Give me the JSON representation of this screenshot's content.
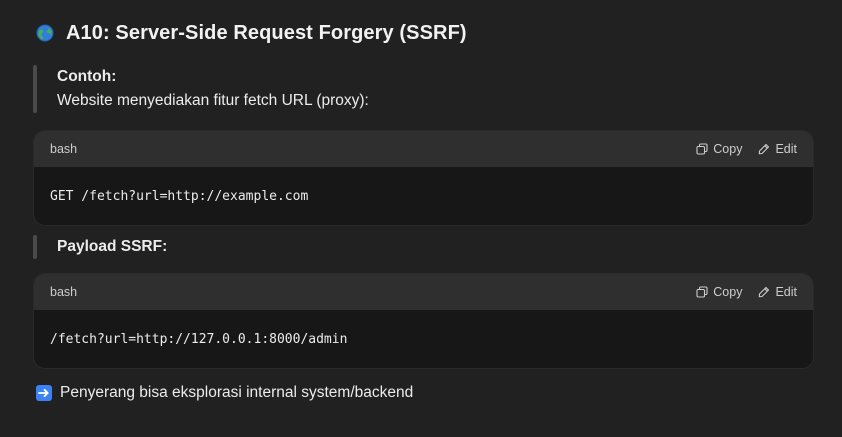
{
  "heading": {
    "icon": "globe-icon",
    "text": "A10: Server-Side Request Forgery (SSRF)"
  },
  "example_quote": {
    "title": "Contoh:",
    "body": "Website menyediakan fitur fetch URL (proxy):"
  },
  "code_blocks": [
    {
      "language": "bash",
      "copy_label": "Copy",
      "edit_label": "Edit",
      "code": "GET /fetch?url=http://example.com"
    },
    {
      "language": "bash",
      "copy_label": "Copy",
      "edit_label": "Edit",
      "code": "/fetch?url=http://127.0.0.1:8000/admin"
    }
  ],
  "payload_quote": {
    "title": "Payload SSRF:"
  },
  "footer": {
    "icon": "right-arrow-icon",
    "text": "Penyerang bisa eksplorasi internal system/backend"
  },
  "colors": {
    "background": "#212121",
    "code_header": "#2f2f2f",
    "code_body": "#171717",
    "arrow_icon_bg": "#3b82f6",
    "quote_bar": "#4a4a4a"
  }
}
